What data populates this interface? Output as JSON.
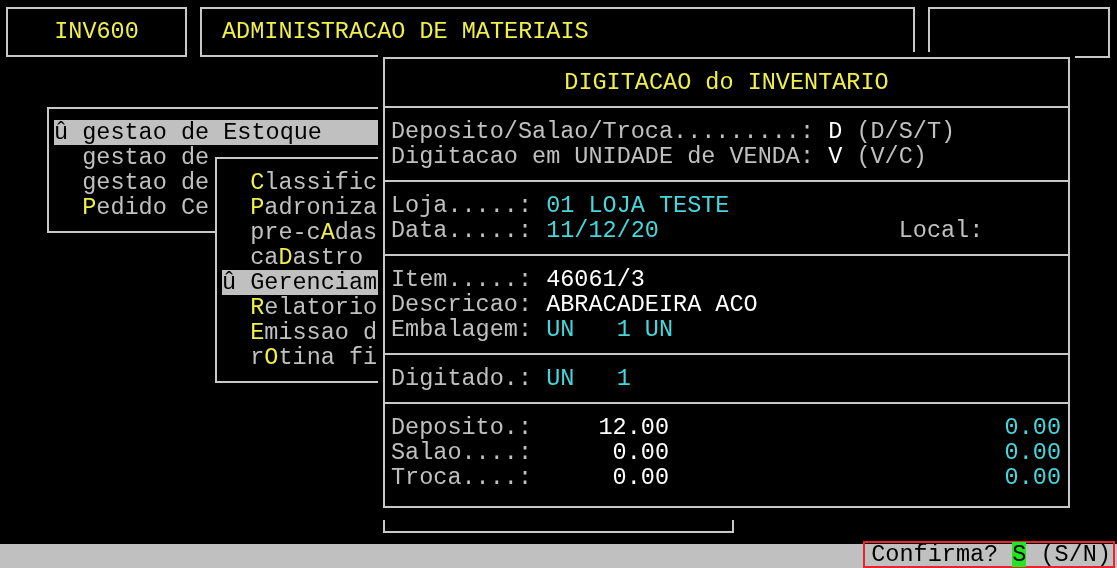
{
  "header": {
    "program": "INV600",
    "title": "ADMINISTRACAO DE MATERIAIS"
  },
  "menus": [
    {
      "items": [
        {
          "marker": "û",
          "text_before": "gestao de Estoque",
          "selected": true
        },
        {
          "text_before": "gestao de",
          "selected": false
        },
        {
          "text_before": "gestao de",
          "selected": false
        },
        {
          "hotkey": "P",
          "text_after": "edido Ce",
          "selected": false
        }
      ]
    },
    {
      "items": [
        {
          "hotkey": "C",
          "text_after": "lassific",
          "selected": false
        },
        {
          "hotkey": "P",
          "text_after": "adroniza",
          "selected": false
        },
        {
          "text_before": "pre-c",
          "hotkey": "A",
          "text_after": "das",
          "selected": false
        },
        {
          "text_before": "ca",
          "hotkey": "D",
          "text_after": "astro",
          "selected": false
        },
        {
          "marker": "û",
          "text_before": "Gerenciam",
          "selected": true
        },
        {
          "hotkey": "R",
          "text_after": "elatorio",
          "selected": false
        },
        {
          "hotkey": "E",
          "text_after": "missao d",
          "selected": false
        },
        {
          "text_before": "r",
          "hotkey": "O",
          "text_after": "tina fi",
          "selected": false
        }
      ]
    }
  ],
  "dialog": {
    "title": "DIGITACAO do INVENTARIO",
    "sections": [
      {
        "rows": [
          {
            "kind": "entry",
            "label": "Deposito/Salao/Troca.........:",
            "value": "D",
            "hint": "(D/S/T)"
          },
          {
            "kind": "entry",
            "label": "Digitacao em UNIDADE de VENDA:",
            "value": "V",
            "hint": "(V/C)"
          }
        ]
      },
      {
        "rows": [
          {
            "kind": "lookup",
            "label": "Loja.....:",
            "value": "01 LOJA TESTE"
          },
          {
            "kind": "lookup",
            "label": "Data.....:",
            "value": "11/12/20",
            "extra_label": "Local:"
          }
        ]
      },
      {
        "rows": [
          {
            "kind": "entry",
            "label": "Item.....:",
            "value": "46061/3"
          },
          {
            "kind": "entry",
            "label": "Descricao:",
            "value": "ABRACADEIRA ACO"
          },
          {
            "kind": "lookup",
            "label": "Embalagem:",
            "value": "UN   1 UN"
          }
        ]
      },
      {
        "rows": [
          {
            "kind": "lookup",
            "label": "Digitado.:",
            "value": "UN   1"
          }
        ]
      },
      {
        "rows": [
          {
            "kind": "amounts",
            "label": "Deposito.:",
            "amount": "12.00",
            "amount_2": "0.00"
          },
          {
            "kind": "amounts",
            "label": "Salao....:",
            "amount": "0.00",
            "amount_2": "0.00"
          },
          {
            "kind": "amounts",
            "label": "Troca....:",
            "amount": "0.00",
            "amount_2": "0.00"
          }
        ]
      }
    ]
  },
  "status_bar": {
    "prompt": "Confirma?",
    "answer": "S",
    "hint": "(S/N)",
    "highlighted": true
  }
}
